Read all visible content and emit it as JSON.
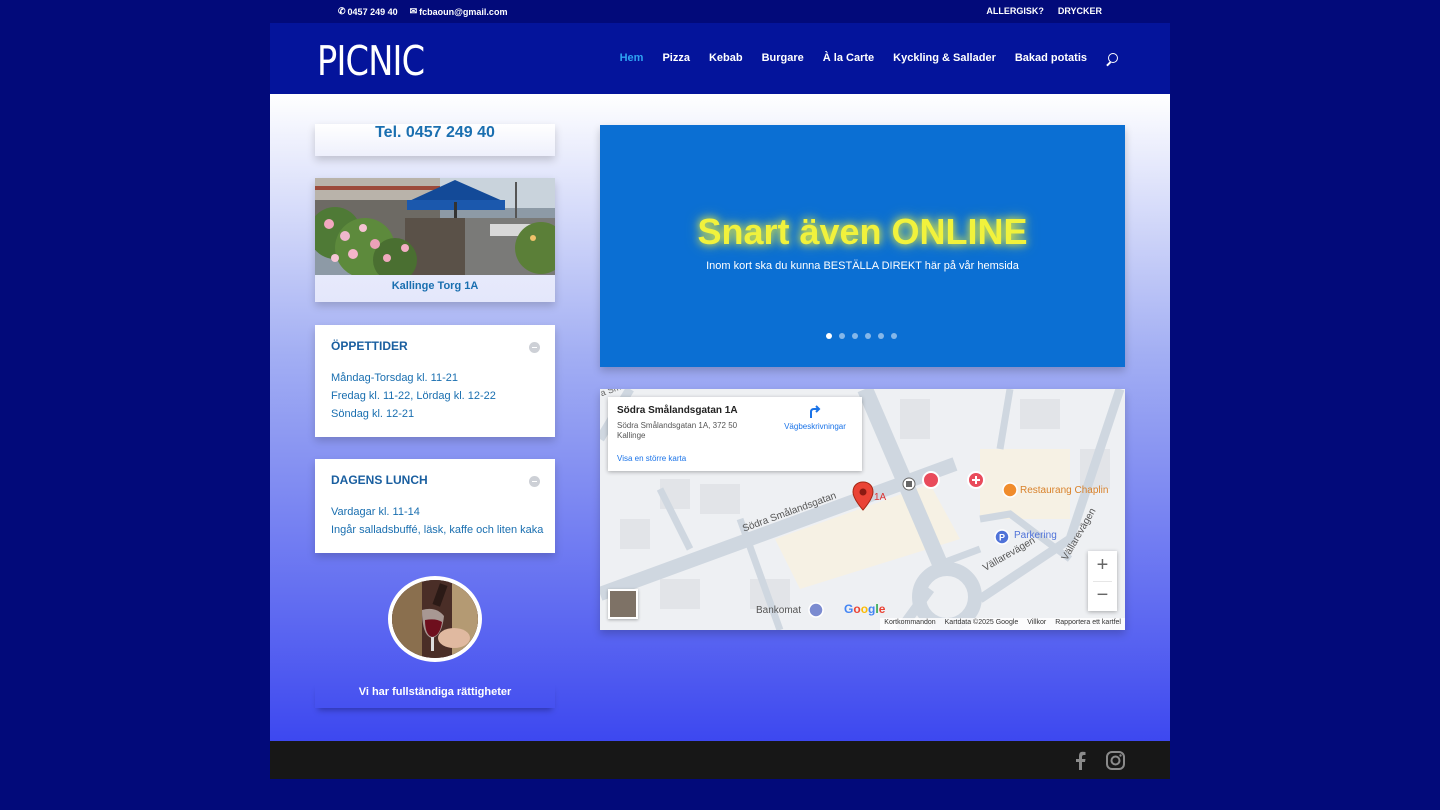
{
  "topbar": {
    "phone": "0457 249 40",
    "email": "fcbaoun@gmail.com",
    "links": [
      "ALLERGISK?",
      "DRYCKER"
    ]
  },
  "header": {
    "logo": "PICNIC",
    "nav": [
      "Hem",
      "Pizza",
      "Kebab",
      "Burgare",
      "À la Carte",
      "Kyckling & Sallader",
      "Bakad potatis"
    ],
    "active_index": 0
  },
  "sidebar": {
    "tel": "Tel. 0457 249 40",
    "photo_caption": "Kallinge Torg 1A",
    "hours": {
      "title": "ÖPPETTIDER",
      "lines": [
        "Måndag-Torsdag kl. 11-21",
        "Fredag kl. 11-22, Lördag kl. 12-22",
        "Söndag kl. 12-21"
      ]
    },
    "lunch": {
      "title": "DAGENS LUNCH",
      "lines": [
        "Vardagar kl. 11-14",
        "Ingår salladsbuffé, läsk, kaffe och liten kaka"
      ]
    },
    "rights": "Vi har fullständiga rättigheter"
  },
  "slider": {
    "heading": "Snart även ONLINE",
    "subtext": "Inom kort ska du kunna BESTÄLLA DIREKT här på vår hemsida",
    "slide_count": 6,
    "active_slide": 0
  },
  "map": {
    "place_title": "Södra Smålandsgatan 1A",
    "place_address": "Södra Smålandsgatan 1A, 372 50 Kallinge",
    "directions": "Vägbeskrivningar",
    "larger_map": "Visa en större karta",
    "labels": {
      "street1": "Södra Smålandsgatan",
      "street2": "Vällarevägen",
      "pin": "1A",
      "restaurant": "Restaurang Chaplin",
      "parking": "Parkering",
      "atm": "Bankomat",
      "google": "Google",
      "partial": "a Sm"
    },
    "attribution": [
      "Kortkommandon",
      "Kartdata ©2025 Google",
      "Villkor",
      "Rapportera ett kartfel"
    ],
    "zoom_in": "+",
    "zoom_out": "−"
  },
  "footer": {
    "icons": [
      "facebook-icon",
      "instagram-icon"
    ]
  },
  "colors": {
    "page_bg": "#020a7a",
    "header_bg": "#04149b",
    "accent": "#2ea3f2",
    "text_blue": "#1a6fb0",
    "slider_bg": "#0b6fd3",
    "headline_yellow": "#f1f23c",
    "footer_bg": "#171717"
  }
}
